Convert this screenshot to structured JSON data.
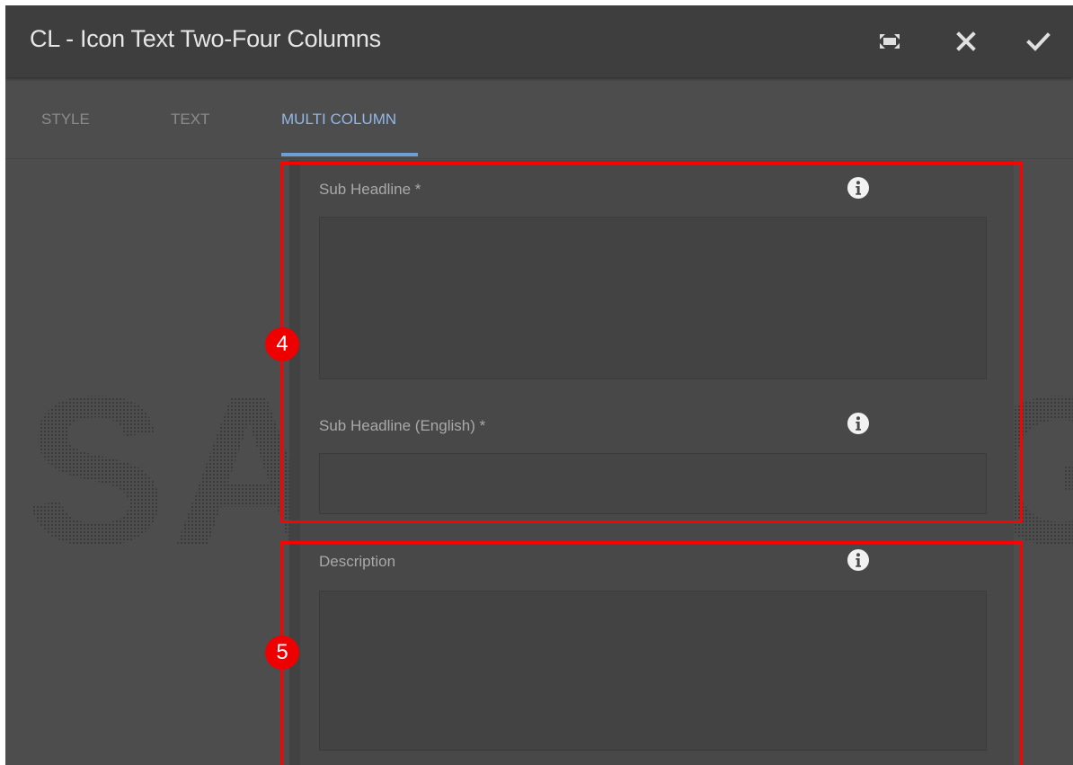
{
  "dialog": {
    "title": "CL - Icon Text Two-Four Columns",
    "actions": {
      "fullscreen_icon": "fullscreen-icon",
      "close_icon": "close-icon",
      "confirm_icon": "checkmark-icon"
    }
  },
  "tabs": [
    {
      "label": "STYLE",
      "active": false
    },
    {
      "label": "TEXT",
      "active": false
    },
    {
      "label": "MULTI COLUMN",
      "active": true
    }
  ],
  "fields": {
    "sub_headline": {
      "label": "Sub Headline *",
      "value": ""
    },
    "sub_headline_english": {
      "label": "Sub Headline (English) *",
      "value": ""
    },
    "description": {
      "label": "Description",
      "value": ""
    }
  },
  "watermark": "SAMSUNG",
  "callouts": [
    {
      "number": "4"
    },
    {
      "number": "5"
    }
  ],
  "colors": {
    "accent": "#6e9ed8",
    "callout": "#ff0000",
    "dialog_background": "#4d4d4d",
    "titlebar_background": "#3e3e3e"
  }
}
